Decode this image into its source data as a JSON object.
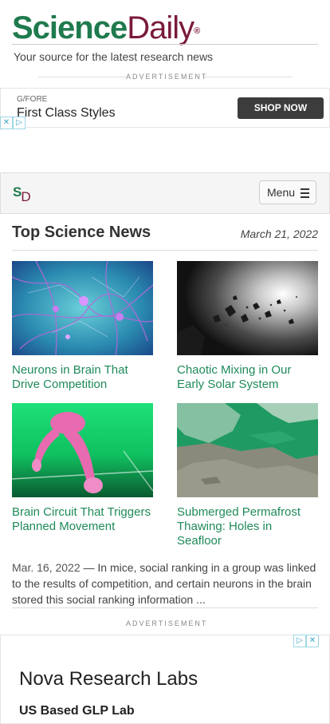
{
  "header": {
    "logo_science": "Science",
    "logo_daily": "Daily",
    "logo_mark": "®",
    "tagline": "Your source for the latest research news"
  },
  "ad_label": "ADVERTISEMENT",
  "ad_top": {
    "brand": "G/FORE",
    "headline": "First Class Styles",
    "button": "SHOP NOW"
  },
  "nav": {
    "logo_s": "S",
    "logo_d": "D",
    "menu_label": "Menu"
  },
  "section": {
    "title": "Top Science News",
    "date": "March 21, 2022"
  },
  "articles": [
    {
      "title": "Neurons in Brain That Drive Competition",
      "image": "neurons-image"
    },
    {
      "title": "Chaotic Mixing in Our Early Solar System",
      "image": "asteroids-image"
    },
    {
      "title": "Brain Circuit That Triggers Planned Movement",
      "image": "runner-image"
    },
    {
      "title": "Submerged Permafrost Thawing: Holes in Seafloor",
      "image": "permafrost-image"
    }
  ],
  "summary": {
    "date": "Mar. 16, 2022",
    "dash": "—",
    "text": "In mice, social ranking in a group was linked to the results of competition, and certain neurons in the brain stored this social ranking information ..."
  },
  "ad_bottom": {
    "title": "Nova Research Labs",
    "subtitle": "US Based GLP Lab"
  },
  "colors": {
    "green": "#1f7a4d",
    "maroon": "#7a1a3a",
    "link": "#1f8a5a"
  }
}
